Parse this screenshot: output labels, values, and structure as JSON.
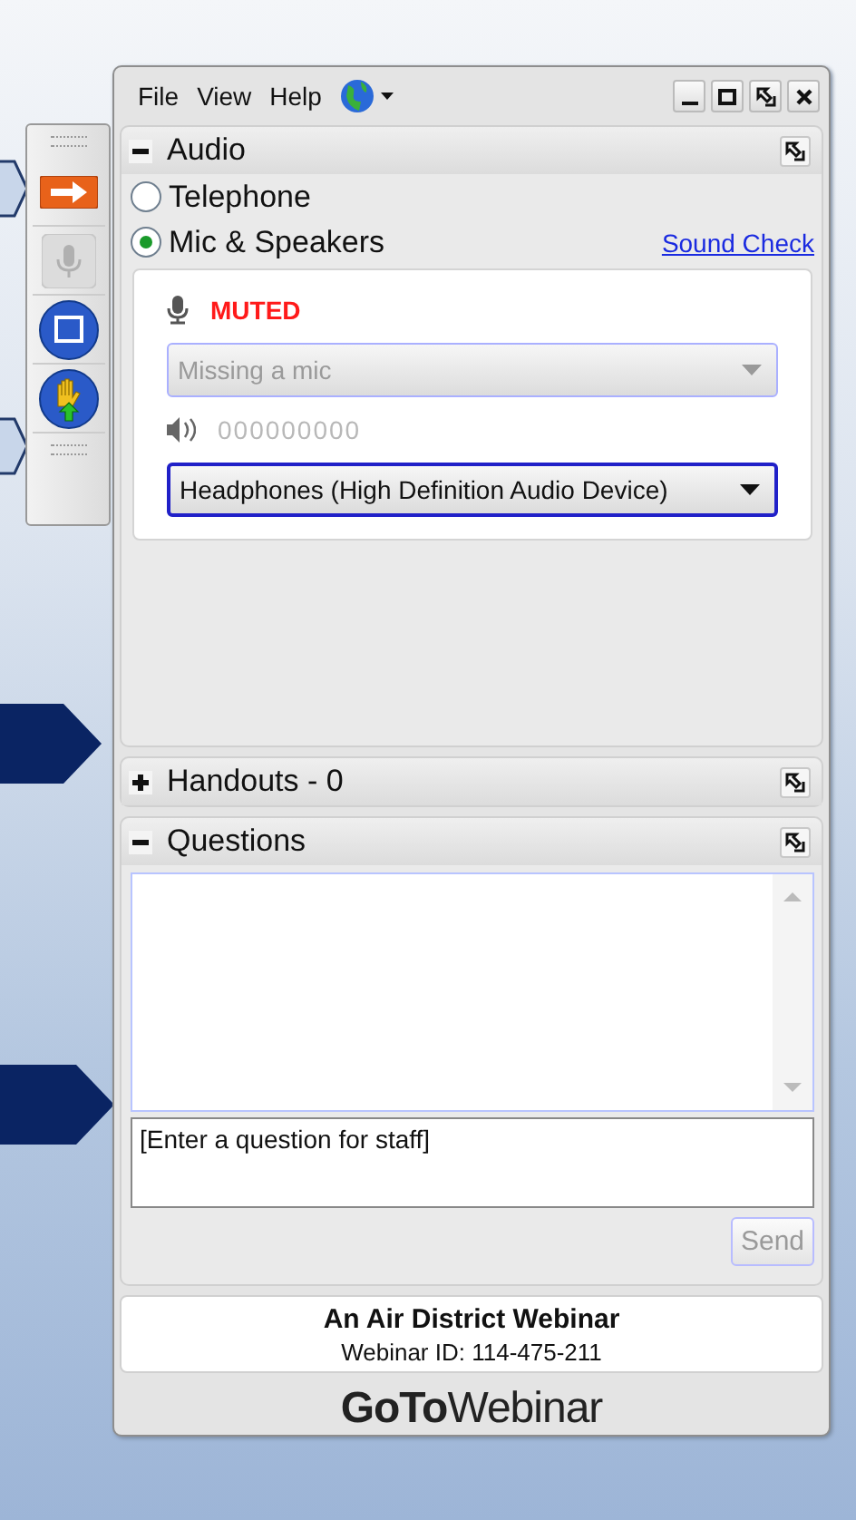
{
  "menu": [
    {
      "label": "File"
    },
    {
      "label": "View"
    },
    {
      "label": "Help"
    }
  ],
  "audio": {
    "title": "Audio",
    "expanded": true,
    "options": [
      {
        "label": "Telephone",
        "selected": false
      },
      {
        "label": "Mic & Speakers",
        "selected": true
      }
    ],
    "link": "Sound Check",
    "mic_status": "MUTED",
    "mic_device": {
      "value": "Missing a mic",
      "disabled": true
    },
    "speaker_level": "000000000",
    "speaker_device": {
      "value": "Headphones (High Definition Audio Device)",
      "disabled": false
    }
  },
  "handouts": {
    "title": "Handouts - 0",
    "expanded": false
  },
  "questions": {
    "title": "Questions",
    "expanded": true,
    "placeholder": "[Enter a question for staff]",
    "send": {
      "label": "Send",
      "disabled": true
    }
  },
  "footer": {
    "title": "An Air District Webinar",
    "webinar_id": "Webinar ID: 114-475-211",
    "logo": "**GoTo**Webinar"
  }
}
